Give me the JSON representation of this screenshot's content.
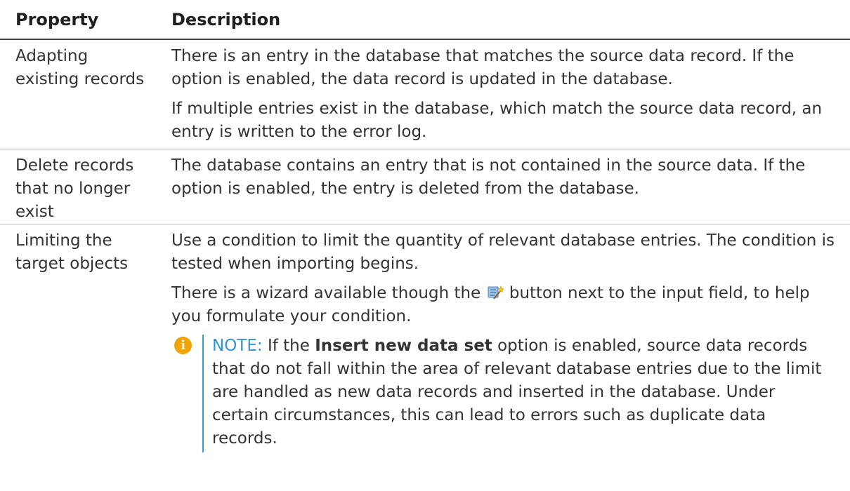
{
  "headers": {
    "property": "Property",
    "description": "Description"
  },
  "rows": [
    {
      "property": "Adapting\nexisting records",
      "paragraphs": [
        "There is an entry in the database that matches the source data record. If the option is enabled, the data record is updated in the database.",
        "If multiple entries exist in the database, which match the source data record, an entry is written to the error log."
      ]
    },
    {
      "property": "Delete records\nthat no longer\nexist",
      "paragraphs": [
        "The database contains an entry that is not contained in the source data. If the option is enabled, the entry is deleted from the database."
      ]
    },
    {
      "property": "Limiting the\ntarget objects",
      "paragraphs": [
        "Use a condition to limit the quantity of relevant database entries. The condition is tested when importing begins."
      ],
      "wizard_before": "There is a wizard available though the",
      "wizard_icon": "wizard-icon",
      "wizard_after": "button next to the input field, to help you formulate your condition.",
      "note": {
        "icon": "info-icon",
        "label": "NOTE:",
        "prefix": "If the",
        "bold_term": "Insert new data set",
        "suffix": "option is enabled, source data records that do not fall within the area of relevant database entries due to the limit are handled as new data records and inserted in the database. Under certain circumstances, this can lead to errors such as duplicate data records."
      }
    }
  ],
  "colors": {
    "note_label": "#2f96d3",
    "note_bar": "#3b9ad6",
    "info_icon": "#f0a30a"
  }
}
